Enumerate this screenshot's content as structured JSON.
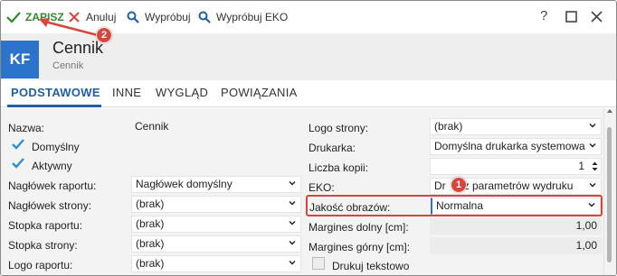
{
  "toolbar": {
    "save_label": "ZAPISZ",
    "cancel_label": "Anuluj",
    "try_label": "Wypróbuj",
    "try_eko_label": "Wypróbuj EKO",
    "help_label": "?"
  },
  "header": {
    "avatar_text": "KF",
    "title": "Cennik",
    "subtitle": "Cennik"
  },
  "tabs": [
    {
      "label": "PODSTAWOWE",
      "active": true
    },
    {
      "label": "INNE",
      "active": false
    },
    {
      "label": "WYGLĄD",
      "active": false
    },
    {
      "label": "POWIĄZANIA",
      "active": false
    }
  ],
  "left": {
    "name_label": "Nazwa:",
    "name_value": "Cennik",
    "default_label": "Domyślny",
    "active_label": "Aktywny",
    "report_header_label": "Nagłówek raportu:",
    "report_header_value": "Nagłówek domyślny",
    "page_header_label": "Nagłówek strony:",
    "page_header_value": "(brak)",
    "report_footer_label": "Stopka raportu:",
    "report_footer_value": "(brak)",
    "page_footer_label": "Stopka strony:",
    "page_footer_value": "(brak)",
    "report_logo_label": "Logo raportu:",
    "report_logo_value": "(brak)"
  },
  "right": {
    "page_logo_label": "Logo strony:",
    "page_logo_value": "(brak)",
    "printer_label": "Drukarka:",
    "printer_value": "Domyślna drukarka systemowa",
    "copies_label": "Liczba kopii:",
    "copies_value": "1",
    "eko_label": "EKO:",
    "eko_value_a": "Dr",
    "eko_value_b": "z parametrów wydruku",
    "image_quality_label": "Jakość obrazów:",
    "image_quality_value": "Normalna",
    "margin_bottom_label": "Margines dolny [cm]:",
    "margin_bottom_value": "1,00",
    "margin_top_label": "Margines górny [cm]:",
    "margin_top_value": "1,00",
    "print_text_label": "Drukuj tekstowo"
  },
  "annotations": {
    "badge_1": "1",
    "badge_2": "2"
  },
  "colors": {
    "accent": "#1f5fa8",
    "save_green": "#2e8b2e",
    "annotation_red": "#d9453a",
    "avatar_blue": "#2b74c9"
  }
}
